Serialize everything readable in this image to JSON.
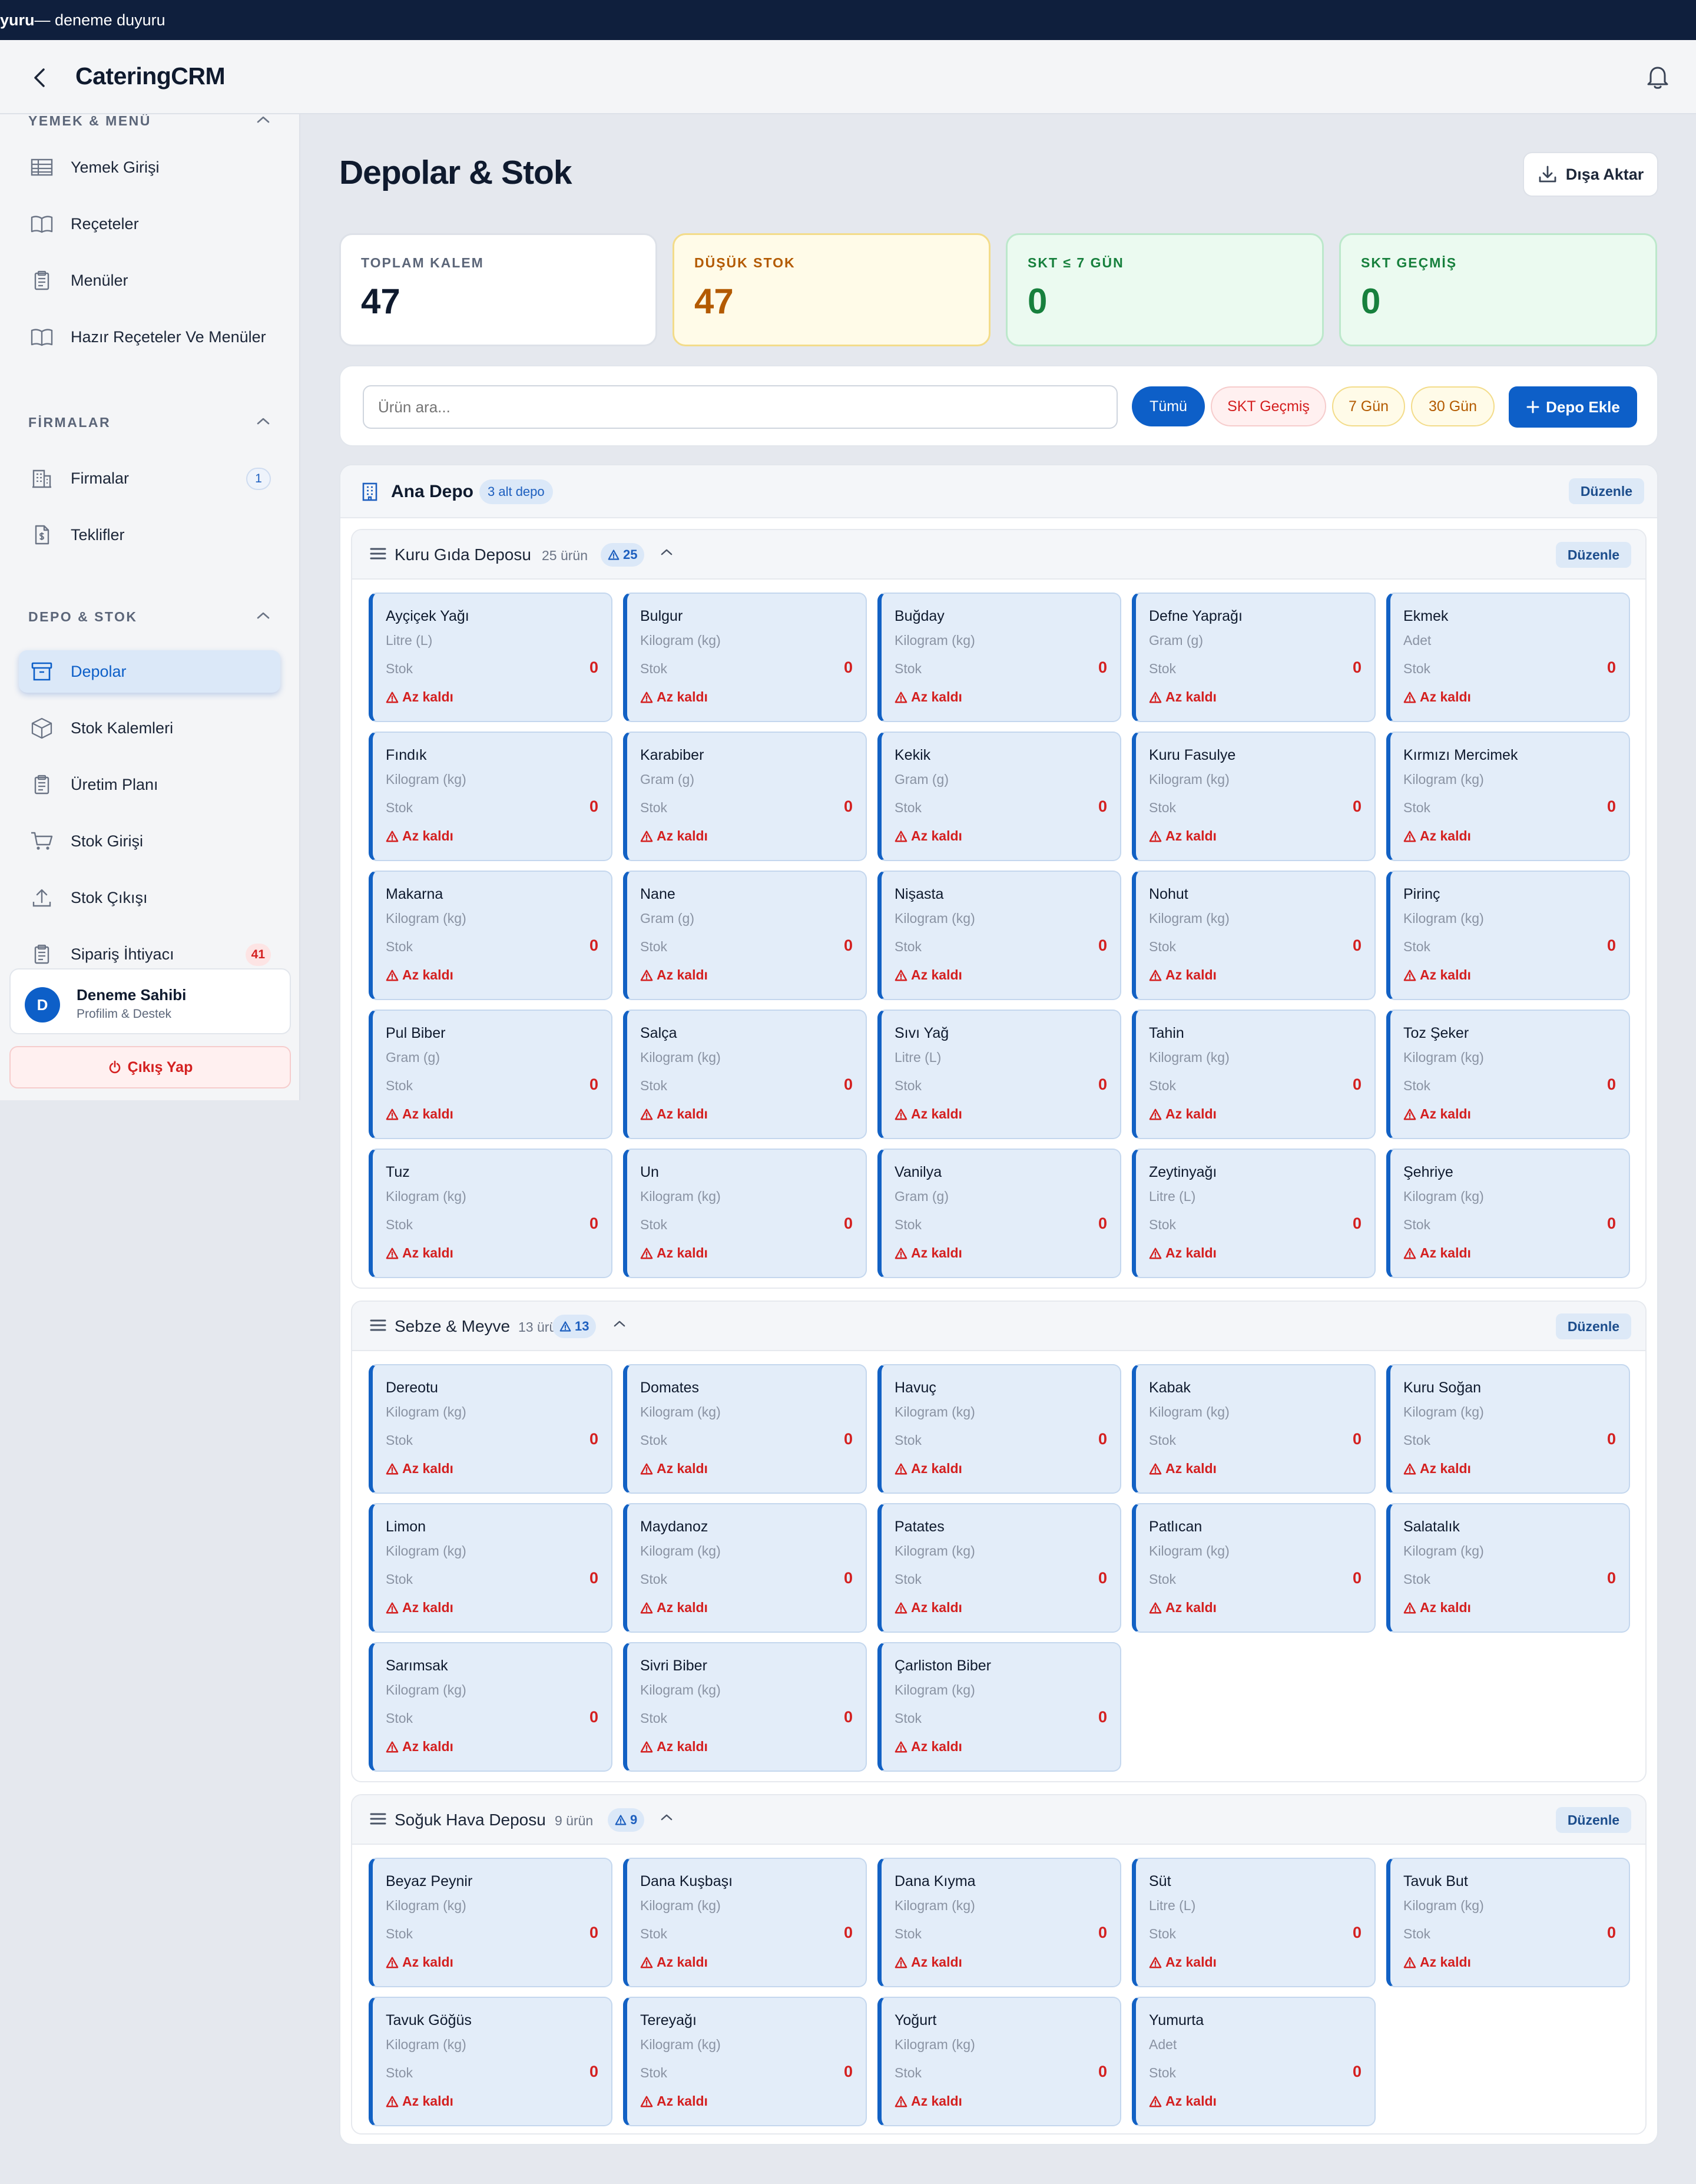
{
  "banner": {
    "prefix": "yuru",
    "rest": " — deneme duyuru"
  },
  "app": {
    "brand": "CateringCRM"
  },
  "sidebar": {
    "sections": [
      {
        "title": "YEMEK & MENÜ",
        "items": [
          {
            "label": "Yemek Girişi",
            "icon": "table-icon"
          },
          {
            "label": "Reçeteler",
            "icon": "book-icon"
          },
          {
            "label": "Menüler",
            "icon": "clipboard-icon"
          },
          {
            "label": "Hazır Reçeteler Ve Menüler",
            "icon": "book-icon"
          }
        ]
      },
      {
        "title": "FİRMALAR",
        "items": [
          {
            "label": "Firmalar",
            "icon": "building-icon",
            "badge": "1"
          },
          {
            "label": "Teklifler",
            "icon": "file-dollar-icon"
          }
        ]
      },
      {
        "title": "DEPO & STOK",
        "items": [
          {
            "label": "Depolar",
            "icon": "archive-icon",
            "active": true
          },
          {
            "label": "Stok Kalemleri",
            "icon": "box-icon"
          },
          {
            "label": "Üretim Planı",
            "icon": "clipboard-icon"
          },
          {
            "label": "Stok Girişi",
            "icon": "cart-icon"
          },
          {
            "label": "Stok Çıkışı",
            "icon": "upload-icon"
          },
          {
            "label": "Sipariş İhtiyacı",
            "icon": "clipboard-icon",
            "badge": "41"
          }
        ]
      }
    ],
    "user": {
      "initial": "D",
      "name": "Deneme Sahibi",
      "sub": "Profilim & Destek"
    },
    "logout": "Çıkış Yap"
  },
  "page": {
    "title": "Depolar & Stok",
    "export": "Dışa Aktar"
  },
  "stats": [
    {
      "label": "TOPLAM KALEM",
      "value": "47",
      "bg": "#ffffff",
      "border": "#dde1e8",
      "label_color": "#5c6679",
      "value_color": "#0f1a2e"
    },
    {
      "label": "DÜŞÜK STOK",
      "value": "47",
      "bg": "#fffbe8",
      "border": "#f3dc8a",
      "label_color": "#b35a00",
      "value_color": "#b35a00"
    },
    {
      "label": "SKT ≤ 7 GÜN",
      "value": "0",
      "bg": "#ebfaf0",
      "border": "#bce8cb",
      "label_color": "#17803d",
      "value_color": "#17803d"
    },
    {
      "label": "SKT GEÇMİŞ",
      "value": "0",
      "bg": "#ebfaf0",
      "border": "#bce8cb",
      "label_color": "#17803d",
      "value_color": "#17803d"
    }
  ],
  "filters": {
    "search_placeholder": "Ürün ara...",
    "pills": [
      "Tümü",
      "SKT Geçmiş",
      "7 Gün",
      "30 Gün"
    ],
    "add": "Depo Ekle"
  },
  "depot": {
    "name": "Ana Depo",
    "badge": "3 alt depo",
    "edit": "Düzenle",
    "stock_label": "Stok",
    "low_label": "Az kaldı",
    "subdepots": [
      {
        "name": "Kuru Gıda Deposu",
        "count": "25 ürün",
        "warn": "25",
        "edit": "Düzenle",
        "items": [
          [
            "Ayçiçek Yağı",
            "Litre (L)",
            "0"
          ],
          [
            "Bulgur",
            "Kilogram (kg)",
            "0"
          ],
          [
            "Buğday",
            "Kilogram (kg)",
            "0"
          ],
          [
            "Defne Yaprağı",
            "Gram (g)",
            "0"
          ],
          [
            "Ekmek",
            "Adet",
            "0"
          ],
          [
            "Fındık",
            "Kilogram (kg)",
            "0"
          ],
          [
            "Karabiber",
            "Gram (g)",
            "0"
          ],
          [
            "Kekik",
            "Gram (g)",
            "0"
          ],
          [
            "Kuru Fasulye",
            "Kilogram (kg)",
            "0"
          ],
          [
            "Kırmızı Mercimek",
            "Kilogram (kg)",
            "0"
          ],
          [
            "Makarna",
            "Kilogram (kg)",
            "0"
          ],
          [
            "Nane",
            "Gram (g)",
            "0"
          ],
          [
            "Nişasta",
            "Kilogram (kg)",
            "0"
          ],
          [
            "Nohut",
            "Kilogram (kg)",
            "0"
          ],
          [
            "Pirinç",
            "Kilogram (kg)",
            "0"
          ],
          [
            "Pul Biber",
            "Gram (g)",
            "0"
          ],
          [
            "Salça",
            "Kilogram (kg)",
            "0"
          ],
          [
            "Sıvı Yağ",
            "Litre (L)",
            "0"
          ],
          [
            "Tahin",
            "Kilogram (kg)",
            "0"
          ],
          [
            "Toz Şeker",
            "Kilogram (kg)",
            "0"
          ],
          [
            "Tuz",
            "Kilogram (kg)",
            "0"
          ],
          [
            "Un",
            "Kilogram (kg)",
            "0"
          ],
          [
            "Vanilya",
            "Gram (g)",
            "0"
          ],
          [
            "Zeytinyağı",
            "Litre (L)",
            "0"
          ],
          [
            "Şehriye",
            "Kilogram (kg)",
            "0"
          ]
        ]
      },
      {
        "name": "Sebze & Meyve",
        "count": "13 ürün",
        "warn": "13",
        "edit": "Düzenle",
        "items": [
          [
            "Dereotu",
            "Kilogram (kg)",
            "0"
          ],
          [
            "Domates",
            "Kilogram (kg)",
            "0"
          ],
          [
            "Havuç",
            "Kilogram (kg)",
            "0"
          ],
          [
            "Kabak",
            "Kilogram (kg)",
            "0"
          ],
          [
            "Kuru Soğan",
            "Kilogram (kg)",
            "0"
          ],
          [
            "Limon",
            "Kilogram (kg)",
            "0"
          ],
          [
            "Maydanoz",
            "Kilogram (kg)",
            "0"
          ],
          [
            "Patates",
            "Kilogram (kg)",
            "0"
          ],
          [
            "Patlıcan",
            "Kilogram (kg)",
            "0"
          ],
          [
            "Salatalık",
            "Kilogram (kg)",
            "0"
          ],
          [
            "Sarımsak",
            "Kilogram (kg)",
            "0"
          ],
          [
            "Sivri Biber",
            "Kilogram (kg)",
            "0"
          ],
          [
            "Çarliston Biber",
            "Kilogram (kg)",
            "0"
          ]
        ]
      },
      {
        "name": "Soğuk Hava Deposu",
        "count": "9 ürün",
        "warn": "9",
        "edit": "Düzenle",
        "items": [
          [
            "Beyaz Peynir",
            "Kilogram (kg)",
            "0"
          ],
          [
            "Dana Kuşbaşı",
            "Kilogram (kg)",
            "0"
          ],
          [
            "Dana Kıyma",
            "Kilogram (kg)",
            "0"
          ],
          [
            "Süt",
            "Litre (L)",
            "0"
          ],
          [
            "Tavuk But",
            "Kilogram (kg)",
            "0"
          ],
          [
            "Tavuk Göğüs",
            "Kilogram (kg)",
            "0"
          ],
          [
            "Tereyağı",
            "Kilogram (kg)",
            "0"
          ],
          [
            "Yoğurt",
            "Kilogram (kg)",
            "0"
          ],
          [
            "Yumurta",
            "Adet",
            "0"
          ]
        ]
      }
    ]
  }
}
